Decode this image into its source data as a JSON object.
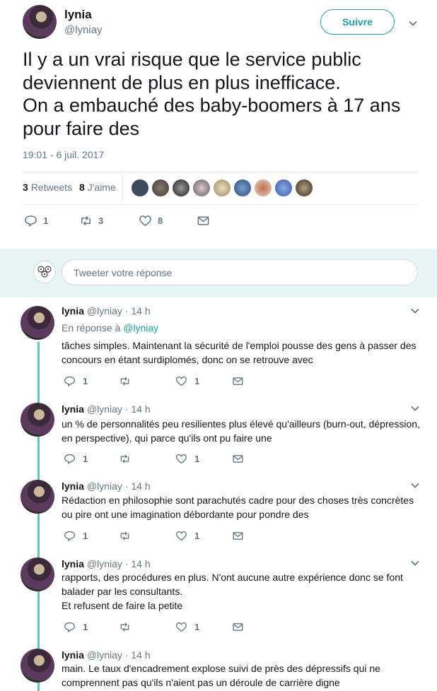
{
  "main_tweet": {
    "name": "lynia",
    "handle": "@lyniay",
    "follow_label": "Suivre",
    "text": "Il y a un vrai risque que le service public deviennent de plus en plus inefficace.\nOn a embauché des baby-boomers à 17 ans pour faire des",
    "timestamp": "19:01 - 6 juil. 2017",
    "retweets_count": "3",
    "retweets_label": "Retweets",
    "likes_count": "8",
    "likes_label": "J'aime",
    "actions": {
      "reply": "1",
      "retweet": "3",
      "like": "8"
    }
  },
  "reply_box": {
    "placeholder": "Tweeter votre réponse"
  },
  "replies": [
    {
      "name": "lynia",
      "handle": "@lyniay",
      "time": "· 14 h",
      "in_reply_prefix": "En réponse à ",
      "in_reply_handle": "@lyniay",
      "text": "tâches simples. Maintenant la sécurité de l'emploi pousse des gens à passer des concours en étant surdiplomés, donc on se retrouve avec",
      "reply_count": "1",
      "like_count": "1"
    },
    {
      "name": "lynia",
      "handle": "@lyniay",
      "time": "· 14 h",
      "text": "un % de personnalités peu resilientes plus élevé qu'ailleurs (burn-out, dépression, en perspective), qui parce qu'ils ont pu faire une",
      "reply_count": "1",
      "like_count": "1"
    },
    {
      "name": "lynia",
      "handle": "@lyniay",
      "time": "· 14 h",
      "text": "Rédaction en philosophie sont parachutés cadre pour des choses très concrètes ou pire ont une imagination débordante pour pondre des",
      "reply_count": "1",
      "like_count": "1"
    },
    {
      "name": "lynia",
      "handle": "@lyniay",
      "time": "· 14 h",
      "text": "rapports, des procédures en plus. N'ont aucune autre expérience donc se font balader par les consultants.\nEt refusent de faire la petite",
      "reply_count": "1",
      "like_count": "1"
    },
    {
      "name": "lynia",
      "handle": "@lyniay",
      "time": "· 14 h",
      "text": "main. Le taux d'encadrement explose suivi de près des dépressifs qui ne comprennent pas qu'ils n'aient pas un déroule de carrière digne",
      "reply_count": "",
      "like_count": ""
    }
  ],
  "colors": {
    "accent": "#1da1a1",
    "thread_line": "#5dcbb8",
    "reply_bg": "#e8f5f3"
  }
}
